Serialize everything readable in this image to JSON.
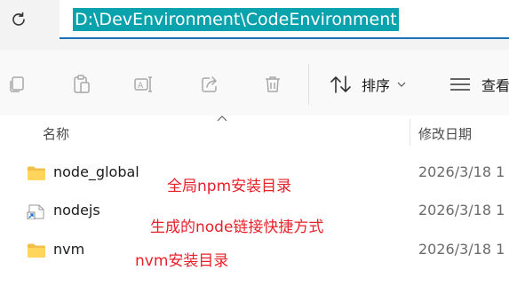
{
  "address_bar": {
    "path": "D:\\DevEnvironment\\CodeEnvironment"
  },
  "toolbar": {
    "icons": [
      "copy-icon",
      "paste-icon",
      "rename-icon",
      "share-icon",
      "delete-icon"
    ],
    "sort_label": "排序",
    "view_label": "查看"
  },
  "columns": {
    "name": "名称",
    "modified": "修改日期"
  },
  "files": [
    {
      "name": "node_global",
      "date": "2026/3/18 1",
      "icon": "folder-icon"
    },
    {
      "name": "nodejs",
      "date": "2026/3/18 1",
      "icon": "shortcut-icon"
    },
    {
      "name": "nvm",
      "date": "2026/3/18 1",
      "icon": "folder-icon"
    }
  ],
  "annotations": [
    {
      "text": "全局npm安装目录",
      "color": "#e8202a"
    },
    {
      "text": "生成的node链接快捷方式",
      "color": "#e8202a"
    },
    {
      "text": "nvm安装目录",
      "color": "#e8202a"
    }
  ]
}
